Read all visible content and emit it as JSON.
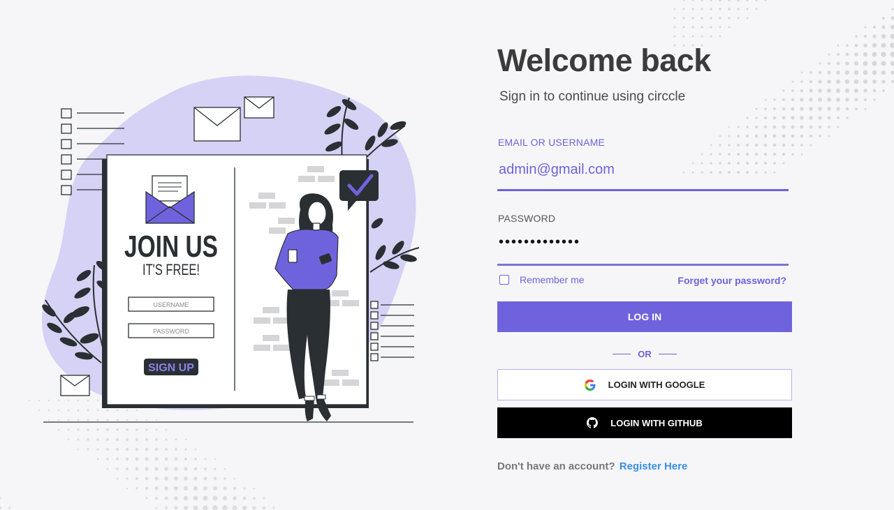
{
  "login": {
    "title": "Welcome back",
    "subtitle": "Sign in to continue using circcle",
    "email_label": "EMAIL OR USERNAME",
    "email_value": "admin@gmail.com",
    "password_label": "PASSWORD",
    "password_value": "•••••••••••••",
    "remember_label": "Remember me",
    "remember_checked": false,
    "forgot_link": "Forget your password?",
    "login_button": "LOG IN",
    "or_text": "OR",
    "google_button": "LOGIN WITH GOOGLE",
    "github_button": "LOGIN WITH GITHUB",
    "no_account_text": "Don't have an account?",
    "register_link": "Register Here"
  },
  "illustration": {
    "join_title": "JOIN US",
    "join_subtitle": "IT'S FREE!",
    "username_placeholder": "USERNAME",
    "password_placeholder": "PASSWORD",
    "signup_label": "SIGN UP"
  },
  "colors": {
    "accent": "#6f63dd",
    "blob": "#d6d2f5",
    "link": "#3a8ee6",
    "dark": "#2a2f33"
  }
}
